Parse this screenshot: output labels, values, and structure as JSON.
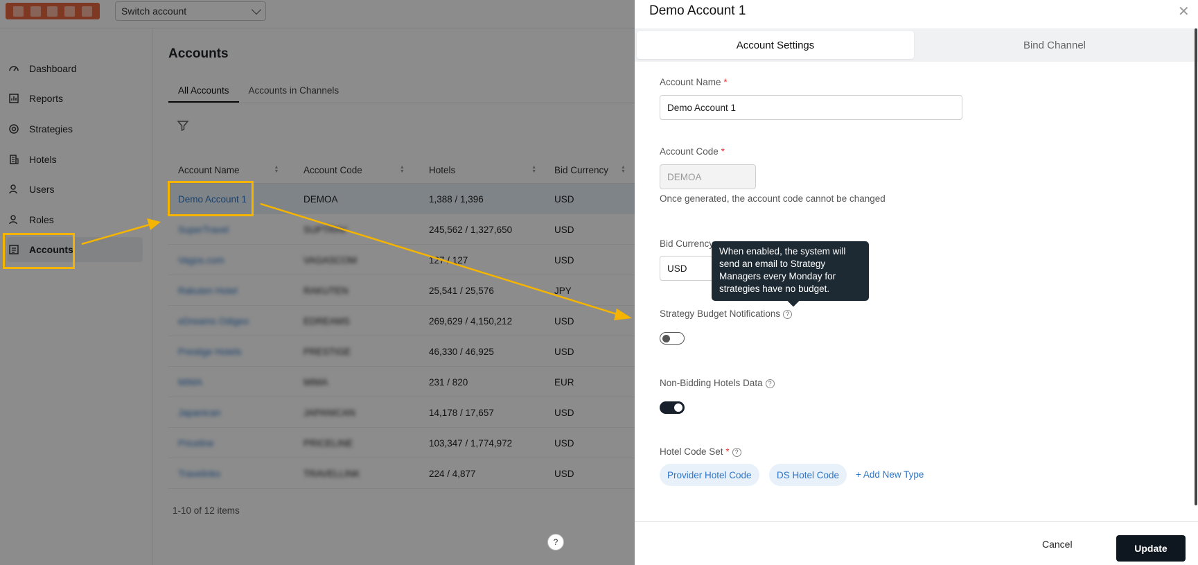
{
  "header": {
    "switch_account": "Switch account"
  },
  "sidebar": {
    "items": [
      {
        "label": "Dashboard",
        "icon": "dashboard-icon"
      },
      {
        "label": "Reports",
        "icon": "reports-icon"
      },
      {
        "label": "Strategies",
        "icon": "strategies-icon"
      },
      {
        "label": "Hotels",
        "icon": "hotels-icon"
      },
      {
        "label": "Users",
        "icon": "users-icon"
      },
      {
        "label": "Roles",
        "icon": "roles-icon"
      },
      {
        "label": "Accounts",
        "icon": "accounts-icon",
        "active": true
      }
    ]
  },
  "main": {
    "title": "Accounts",
    "tabs": [
      {
        "label": "All Accounts",
        "active": true
      },
      {
        "label": "Accounts in Channels"
      }
    ],
    "columns": [
      "Account Name",
      "Account Code",
      "Hotels",
      "Bid Currency"
    ],
    "rows": [
      {
        "name": "Demo Account 1",
        "code": "DEMOA",
        "hotels": "1,388 / 1,396",
        "currency": "USD"
      },
      {
        "name": "SuperTravel",
        "code": "SUPTRAV",
        "hotels": "245,562 / 1,327,650",
        "currency": "USD"
      },
      {
        "name": "Vagos.com",
        "code": "VAGASCOM",
        "hotels": "127 / 127",
        "currency": "USD"
      },
      {
        "name": "Rakuten Hotel",
        "code": "RAKUTEN",
        "hotels": "25,541 / 25,576",
        "currency": "JPY"
      },
      {
        "name": "eDreams Odigeo",
        "code": "EDREAMS",
        "hotels": "269,629 / 4,150,212",
        "currency": "USD"
      },
      {
        "name": "Prestige Hotels",
        "code": "PRESTIGE",
        "hotels": "46,330 / 46,925",
        "currency": "USD"
      },
      {
        "name": "MIMA",
        "code": "MIMA",
        "hotels": "231 / 820",
        "currency": "EUR"
      },
      {
        "name": "Japanican",
        "code": "JAPANICAN",
        "hotels": "14,178 / 17,657",
        "currency": "USD"
      },
      {
        "name": "Priceline",
        "code": "PRICELINE",
        "hotels": "103,347 / 1,774,972",
        "currency": "USD"
      },
      {
        "name": "Travelinks",
        "code": "TRAVELLINK",
        "hotels": "224 / 4,877",
        "currency": "USD"
      }
    ],
    "pagination": "1-10 of 12 items"
  },
  "drawer": {
    "title": "Demo Account 1",
    "tabs": [
      "Account Settings",
      "Bind Channel"
    ],
    "account_name_label": "Account Name",
    "account_name_value": "Demo Account 1",
    "account_code_label": "Account Code",
    "account_code_value": "DEMOA",
    "account_code_help": "Once generated, the account code cannot be changed",
    "bid_currency_label": "Bid Currency",
    "bid_currency_value": "USD",
    "tooltip": "When enabled, the system will send an email to Strategy Managers every Monday for strategies have no budget.",
    "strategy_budget_label": "Strategy Budget Notifications",
    "strategy_budget_enabled": false,
    "non_bidding_label": "Non-Bidding Hotels Data",
    "non_bidding_enabled": true,
    "hotel_code_set_label": "Hotel Code Set",
    "hotel_code_chips": [
      "Provider Hotel Code",
      "DS Hotel Code"
    ],
    "add_new_type": "+ Add New Type",
    "cancel": "Cancel",
    "update": "Update"
  },
  "colors": {
    "accent_link": "#2f76c6",
    "annotation": "#f5b400",
    "primary_button": "#0e1620"
  }
}
